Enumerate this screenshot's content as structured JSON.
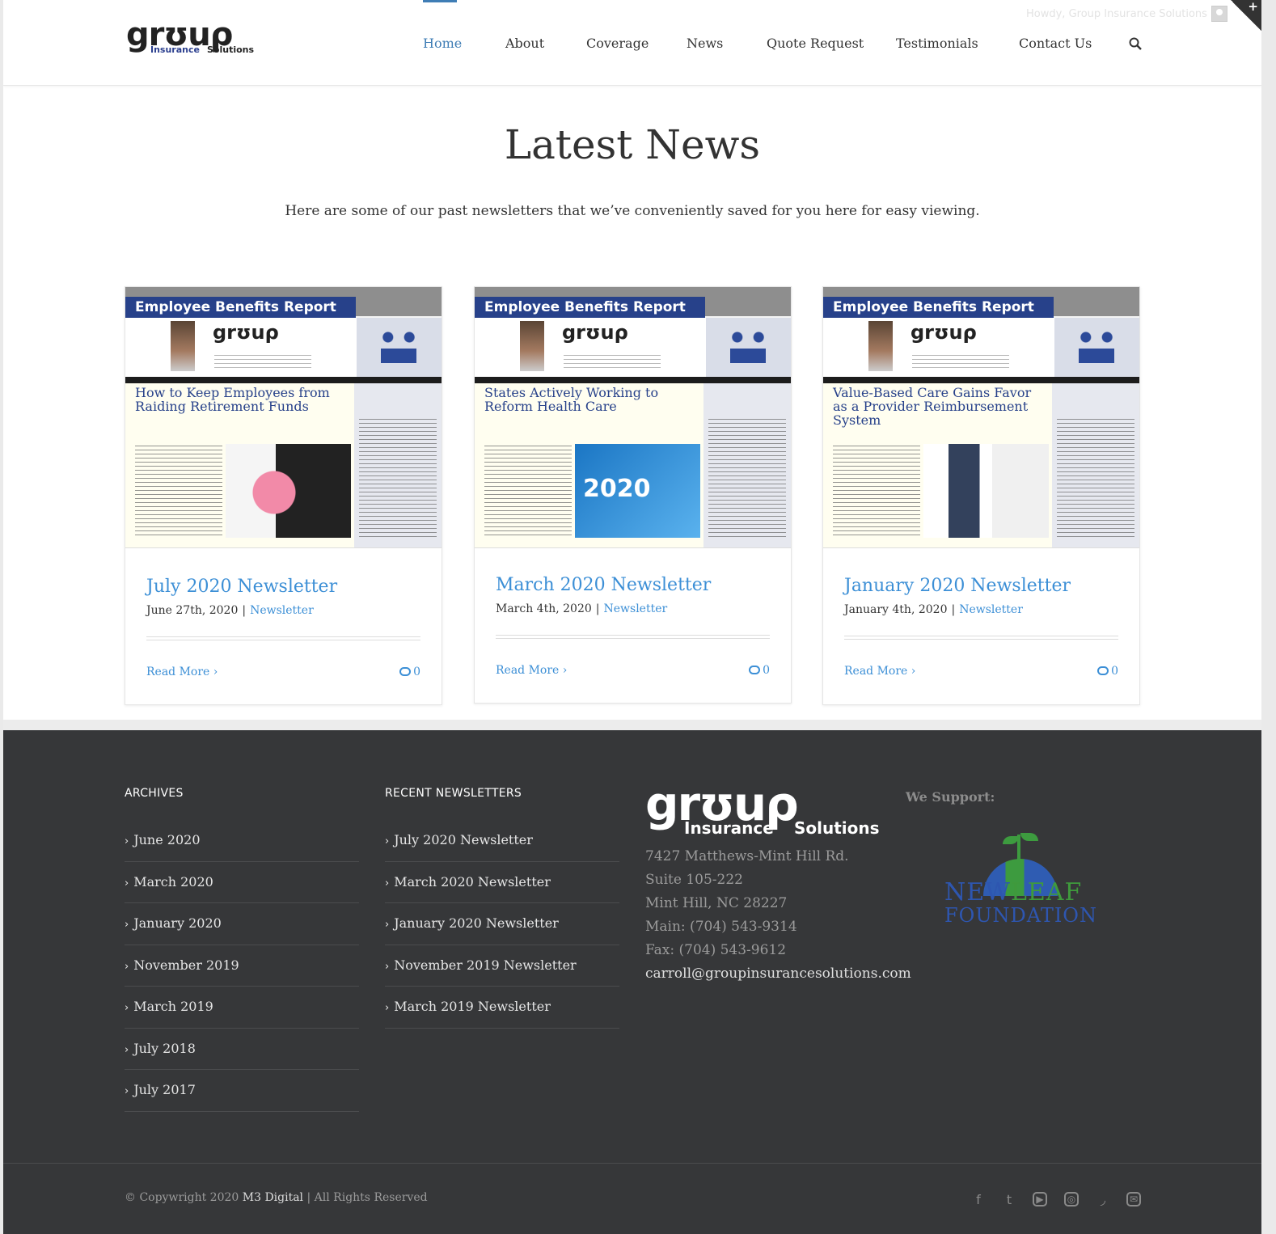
{
  "header": {
    "logo": {
      "big": "grʊuρ",
      "insurance": "Insurance",
      "solutions": "Solutions"
    },
    "nav": [
      {
        "label": "Home",
        "active": true
      },
      {
        "label": "About"
      },
      {
        "label": "Coverage"
      },
      {
        "label": "News"
      },
      {
        "label": "Quote Request"
      },
      {
        "label": "Testimonials"
      },
      {
        "label": "Contact Us"
      }
    ],
    "howdy": "Howdy, Group Insurance Solutions",
    "corner_plus": "+"
  },
  "main": {
    "title": "Latest News",
    "intro": "Here are some of our past newsletters that we’ve conveniently saved for you here for easy viewing."
  },
  "posts": [
    {
      "thumb_report": "Employee Benefits Report",
      "thumb_headline": "How to Keep Employees from Raiding Retirement Funds",
      "title": "July 2020 Newsletter",
      "date": "June 27th, 2020",
      "category": "Newsletter",
      "read_more": "Read More",
      "comments": "0"
    },
    {
      "thumb_report": "Employee Benefits Report",
      "thumb_headline": "States Actively Working to Reform Health Care",
      "thumb_pic_text": "2020",
      "title": "March 2020 Newsletter",
      "date": "March 4th, 2020",
      "category": "Newsletter",
      "read_more": "Read More",
      "comments": "0"
    },
    {
      "thumb_report": "Employee Benefits Report",
      "thumb_headline": "Value-Based Care Gains Favor as a Provider Reimbursement System",
      "title": "January 2020 Newsletter",
      "date": "January 4th, 2020",
      "category": "Newsletter",
      "read_more": "Read More",
      "comments": "0"
    }
  ],
  "footer": {
    "archives": {
      "heading": "ARCHIVES",
      "items": [
        "June 2020",
        "March 2020",
        "January 2020",
        "November 2019",
        "March 2019",
        "July 2018",
        "July 2017"
      ]
    },
    "recent": {
      "heading": "RECENT NEWSLETTERS",
      "items": [
        "July 2020 Newsletter",
        "March 2020 Newsletter",
        "January 2020 Newsletter",
        "November 2019 Newsletter",
        "March 2019 Newsletter"
      ]
    },
    "contact": {
      "logo": {
        "big": "grʊuρ",
        "insurance": "Insurance",
        "solutions": "Solutions"
      },
      "address1": "7427 Matthews-Mint Hill Rd.",
      "address2": "Suite 105-222",
      "city": "Mint Hill, NC 28227",
      "main_phone": "Main: (704) 543-9314",
      "fax": "Fax:  (704) 543-9612",
      "email": "carroll@groupinsurancesolutions.com"
    },
    "support": {
      "heading": "We Support:",
      "logo_line1_a": "NEW",
      "logo_line1_b": "LEAF",
      "logo_line2": "FOUNDATION"
    },
    "copyright_prefix": "© Copywright 2020 ",
    "copyright_brand": "M3 Digital",
    "copyright_suffix": " | All Rights Reserved",
    "social": [
      "facebook-icon",
      "twitter-icon",
      "youtube-icon",
      "instagram-icon",
      "rss-icon",
      "email-icon"
    ]
  },
  "colors": {
    "accent": "#3c8fd6",
    "footer_bg": "#363739"
  }
}
